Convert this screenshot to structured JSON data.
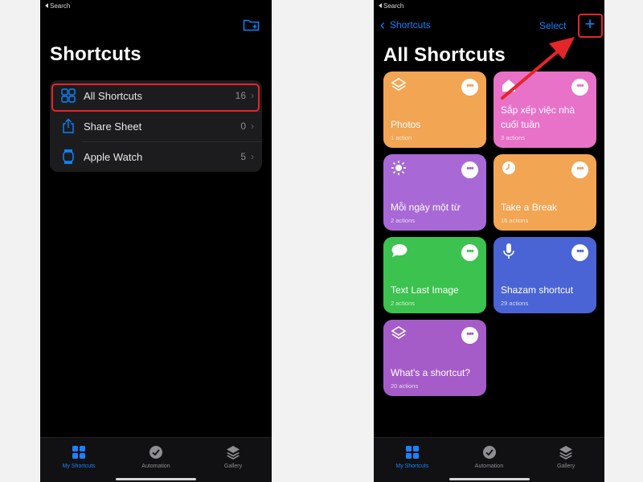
{
  "left": {
    "status": "Search",
    "title": "Shortcuts",
    "icons": {
      "header": "new-folder-icon"
    },
    "list": [
      {
        "label": "All Shortcuts",
        "count": "16",
        "icon": "grid-icon"
      },
      {
        "label": "Share Sheet",
        "count": "0",
        "icon": "share-icon"
      },
      {
        "label": "Apple Watch",
        "count": "5",
        "icon": "watch-icon"
      }
    ],
    "tabs": [
      {
        "label": "My Shortcuts",
        "icon": "grid-icon",
        "active": true
      },
      {
        "label": "Automation",
        "icon": "clock-check-icon",
        "active": false
      },
      {
        "label": "Gallery",
        "icon": "layers-icon",
        "active": false
      }
    ]
  },
  "right": {
    "status": "Search",
    "back_label": "Shortcuts",
    "select_label": "Select",
    "add_label": "+",
    "title": "All Shortcuts",
    "cards": [
      {
        "title": "Photos",
        "subtitle": "1 action",
        "color": "#f2a553",
        "icon": "layers-icon"
      },
      {
        "title": "Sắp xếp việc nhà cuối tuần",
        "subtitle": "3 actions",
        "color": "#e872c8",
        "icon": "home-icon"
      },
      {
        "title": "Mỗi ngày một từ",
        "subtitle": "2 actions",
        "color": "#a869d6",
        "icon": "sun-icon"
      },
      {
        "title": "Take a Break",
        "subtitle": "16 actions",
        "color": "#f2a553",
        "icon": "clock-icon"
      },
      {
        "title": "Text Last Image",
        "subtitle": "2 actions",
        "color": "#3cc24e",
        "icon": "chat-bubble-icon"
      },
      {
        "title": "Shazam shortcut",
        "subtitle": "29 actions",
        "color": "#4a64d6",
        "icon": "microphone-icon"
      },
      {
        "title": "What's a shortcut?",
        "subtitle": "20 actions",
        "color": "#a55cc9",
        "icon": "layers-icon"
      }
    ],
    "tabs": [
      {
        "label": "My Shortcuts",
        "icon": "grid-icon",
        "active": true
      },
      {
        "label": "Automation",
        "icon": "clock-check-icon",
        "active": false
      },
      {
        "label": "Gallery",
        "icon": "layers-icon",
        "active": false
      }
    ]
  },
  "colors": {
    "accent": "#0a84ff",
    "highlight": "#e5252a",
    "background": "#000000",
    "list_bg": "#1c1c1e"
  }
}
